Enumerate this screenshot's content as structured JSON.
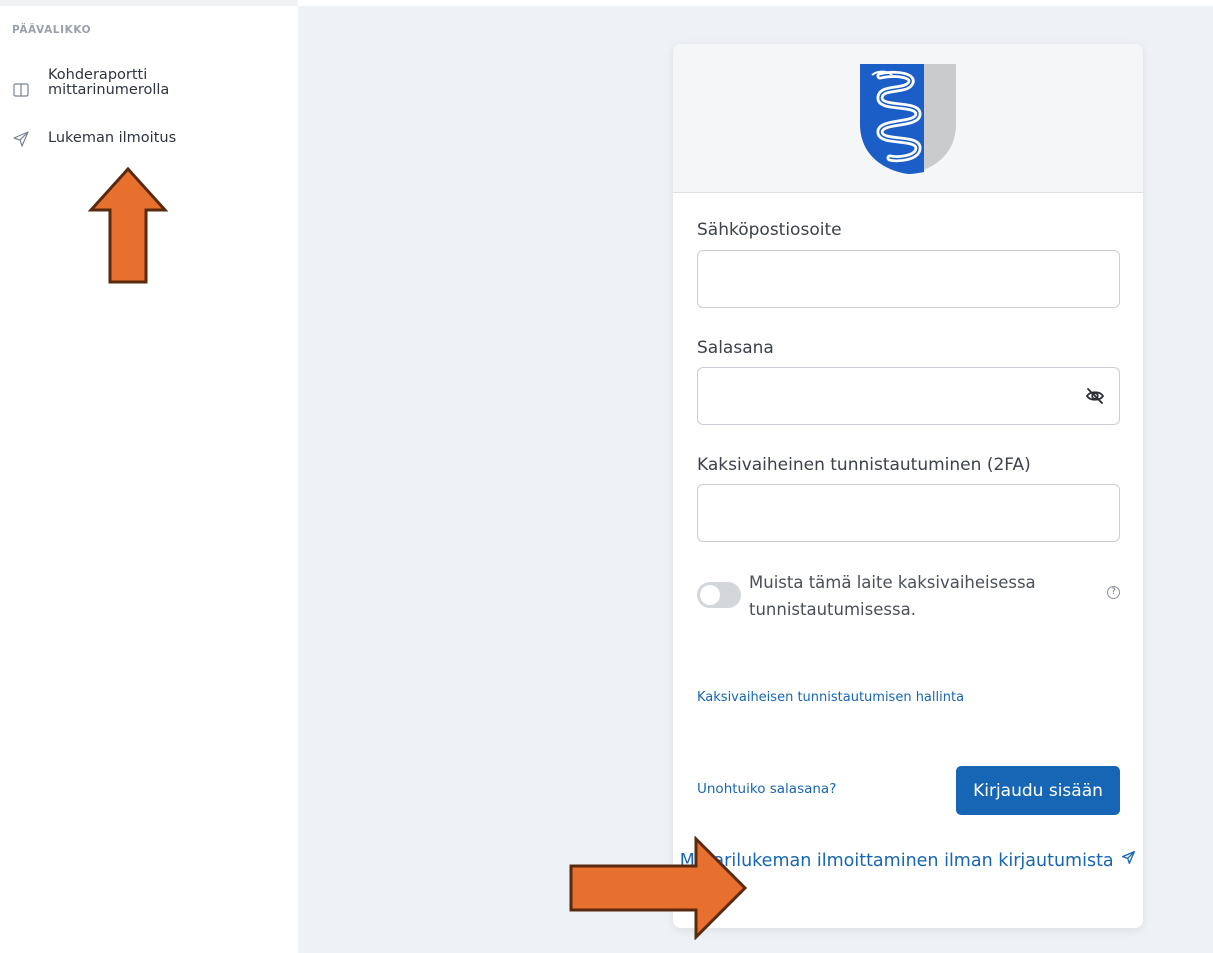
{
  "sidebar": {
    "heading": "PÄÄVALIKKO",
    "items": [
      {
        "label": "Kohderaportti mittarinumerolla",
        "icon": "book-open-icon"
      },
      {
        "label": "Lukeman ilmoitus",
        "icon": "send-icon"
      }
    ]
  },
  "login": {
    "email_label": "Sähköpostiosoite",
    "email_value": "",
    "password_label": "Salasana",
    "password_value": "",
    "twofa_label": "Kaksivaiheinen tunnistautuminen (2FA)",
    "twofa_value": "",
    "remember_label": "Muista tämä laite kaksivaiheisessa tunnistautumisessa.",
    "remember_on": false,
    "help_glyph": "?",
    "manage_2fa_link": "Kaksivaiheisen tunnistautumisen hallinta",
    "forgot_link": "Unohtuiko salasana?",
    "login_button": "Kirjaudu sisään",
    "report_without_login_link": "Mittarilukeman ilmoittaminen ilman kirjautumista"
  },
  "colors": {
    "accent": "#1766b5",
    "crest_blue": "#1b5ec7",
    "crest_silver": "#c9cbcd",
    "annotation_arrow": "#e8702f",
    "annotation_outline": "#5a2a0f",
    "main_bg": "#eef1f6"
  }
}
